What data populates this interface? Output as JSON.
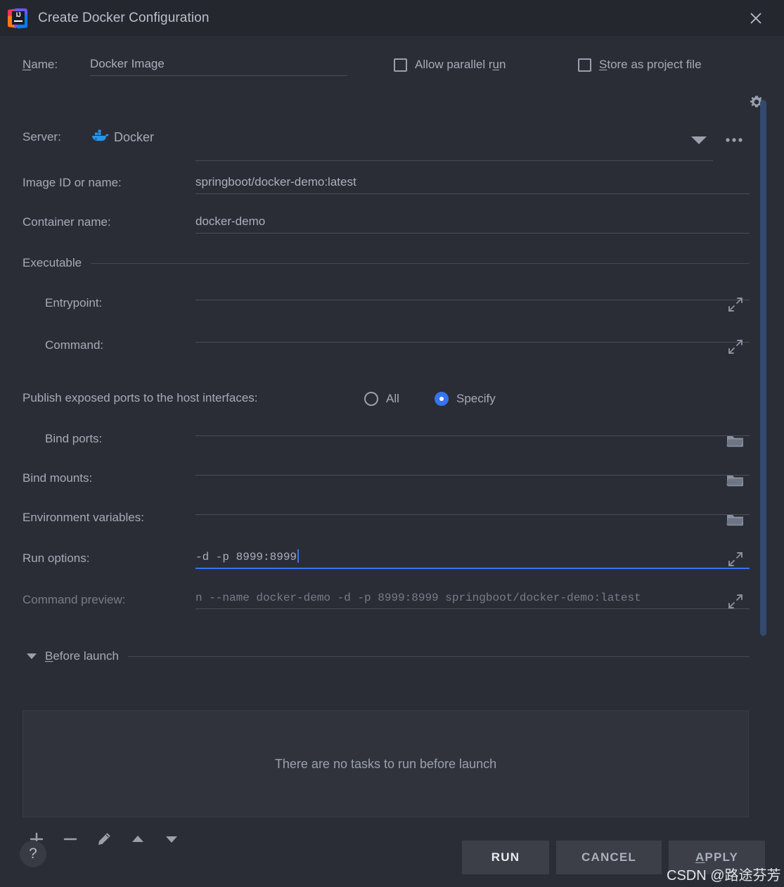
{
  "window": {
    "title": "Create Docker Configuration",
    "logo_icon": "intellij-idea-logo",
    "close_icon": "close-icon"
  },
  "name_row": {
    "label": "Name:",
    "label_mnemonic": "N",
    "value": "Docker Image",
    "placeholder": "Docker Image"
  },
  "options": {
    "allow_parallel_run": {
      "label_pre": "Allow parallel r",
      "label_mnemonic": "u",
      "label_post": "n",
      "checked": false
    },
    "store_as_project_file": {
      "label_mnemonic": "S",
      "label_post": "tore as project file",
      "checked": false
    },
    "gear_icon": "gear-dropdown-icon"
  },
  "server": {
    "label": "Server:",
    "value": "Docker",
    "icon": "docker-whale-icon",
    "dropdown_icon": "chevron-down-icon",
    "more_button": "..."
  },
  "fields": {
    "image_id": {
      "label": "Image ID or name:",
      "value": "springboot/docker-demo:latest"
    },
    "container_name": {
      "label": "Container name:",
      "value": "docker-demo"
    },
    "executable_section": "Executable",
    "entrypoint": {
      "label": "Entrypoint:",
      "value": "",
      "expand_icon": "expand-icon"
    },
    "command": {
      "label": "Command:",
      "value": "",
      "expand_icon": "expand-icon"
    },
    "bind_ports": {
      "label": "Bind ports:",
      "value": "",
      "folder_icon": "folder-icon"
    },
    "bind_mounts": {
      "label": "Bind mounts:",
      "value": "",
      "folder_icon": "folder-icon"
    },
    "environment_variables": {
      "label": "Environment variables:",
      "value": "",
      "folder_icon": "folder-icon"
    },
    "run_options": {
      "label": "Run options:",
      "value": "-d -p 8999:8999",
      "focused": true,
      "expand_icon": "expand-icon"
    },
    "command_preview": {
      "label": "Command preview:",
      "value": "n --name docker-demo -d -p 8999:8999 springboot/docker-demo:latest",
      "expand_icon": "expand-icon"
    }
  },
  "publish_ports": {
    "label": "Publish exposed ports to the host interfaces:",
    "options": [
      {
        "label": "All",
        "selected": false
      },
      {
        "label": "Specify",
        "selected": true
      }
    ]
  },
  "before_launch": {
    "title_mnemonic": "B",
    "title_post": "efore launch",
    "expanded": true,
    "empty_message": "There are no tasks to run before launch",
    "toolbar": [
      {
        "name": "add-task-button",
        "icon": "plus-icon"
      },
      {
        "name": "remove-task-button",
        "icon": "minus-icon"
      },
      {
        "name": "edit-task-button",
        "icon": "pencil-icon"
      },
      {
        "name": "move-up-button",
        "icon": "arrow-up-icon"
      },
      {
        "name": "move-down-button",
        "icon": "arrow-down-icon"
      }
    ]
  },
  "footer": {
    "help_label": "?",
    "run_label": "RUN",
    "cancel_label": "CANCEL",
    "apply_mnemonic": "A",
    "apply_post": "PPLY"
  },
  "watermark": "CSDN @路途芬芳",
  "colors": {
    "background": "#2b2d36",
    "titlebar": "#25272e",
    "accent": "#3574f0",
    "docker_blue": "#2396ed",
    "text": "#a9b0bb",
    "field_underline": "#4a4d57",
    "scrollbar": "#34496e"
  }
}
